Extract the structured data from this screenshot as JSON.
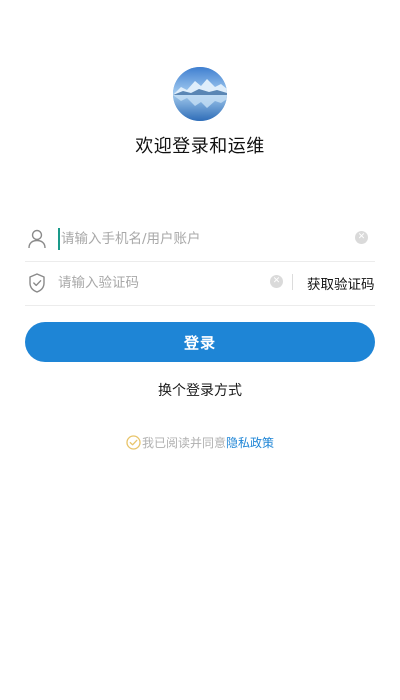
{
  "header": {
    "avatar_icon": "mountain-lake-avatar-icon",
    "welcome_text": "欢迎登录和运维"
  },
  "form": {
    "account": {
      "icon": "user-icon",
      "placeholder": "请输入手机名/用户账户",
      "value": "",
      "clear_icon": "clear-icon",
      "clear_symbol": "✕"
    },
    "code": {
      "icon": "shield-icon",
      "placeholder": "请输入验证码",
      "value": "",
      "clear_icon": "clear-icon",
      "clear_symbol": "✕",
      "get_code_label": "获取验证码"
    }
  },
  "actions": {
    "login_label": "登录",
    "switch_method_label": "换个登录方式"
  },
  "agreement": {
    "check_icon": "check-circle-icon",
    "text": "我已阅读并同意",
    "link_label": "隐私政策"
  },
  "colors": {
    "primary": "#1e85d6",
    "check": "#e8c46a",
    "placeholder": "#a8a8a8"
  }
}
